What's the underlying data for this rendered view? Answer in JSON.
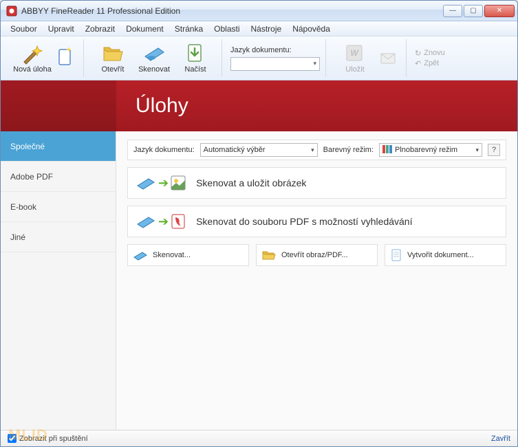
{
  "window": {
    "title": "ABBYY FineReader 11 Professional Edition"
  },
  "menu": {
    "items": [
      "Soubor",
      "Upravit",
      "Zobrazit",
      "Dokument",
      "Stránka",
      "Oblasti",
      "Nástroje",
      "Nápověda"
    ]
  },
  "toolbar": {
    "new_task": "Nová úloha",
    "open": "Otevřít",
    "scan": "Skenovat",
    "load": "Načíst",
    "lang_label": "Jazyk dokumentu:",
    "lang_value": "",
    "save": "Uložit",
    "redo": "Znovu",
    "back": "Zpět"
  },
  "banner": {
    "title": "Úlohy"
  },
  "sidebar": {
    "items": [
      {
        "label": "Společné",
        "active": true
      },
      {
        "label": "Adobe PDF",
        "active": false
      },
      {
        "label": "E-book",
        "active": false
      },
      {
        "label": "Jiné",
        "active": false
      }
    ]
  },
  "pane": {
    "lang_label": "Jazyk dokumentu:",
    "lang_value": "Automatický výběr",
    "color_label": "Barevný režim:",
    "color_value": "Plnobarevný režim",
    "help": "?",
    "tasks": [
      {
        "label": "Skenovat a uložit obrázek"
      },
      {
        "label": "Skenovat do souboru PDF s možností vyhledávání"
      }
    ],
    "small_tasks": [
      {
        "label": "Skenovat..."
      },
      {
        "label": "Otevřít obraz/PDF..."
      },
      {
        "label": "Vytvořit dokument..."
      }
    ]
  },
  "status": {
    "show_on_start": "Zobrazit při spuštění",
    "close": "Zavřít"
  },
  "watermark": "MLID"
}
